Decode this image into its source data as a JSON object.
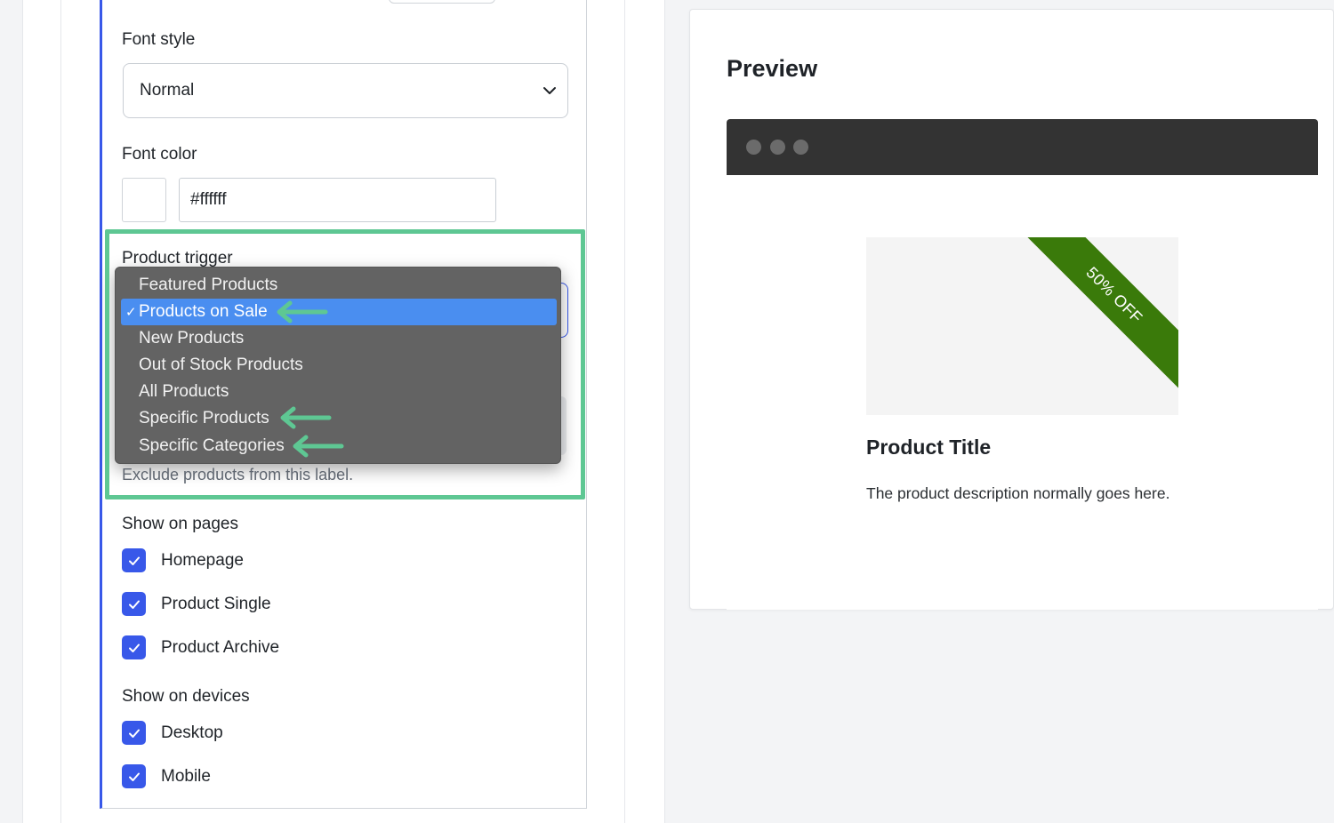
{
  "settings": {
    "font_style": {
      "label": "Font style",
      "value": "Normal"
    },
    "font_color": {
      "label": "Font color",
      "value": "#ffffff",
      "swatch_color": "#ffffff"
    },
    "product_trigger": {
      "label": "Product trigger",
      "options": [
        {
          "label": "Featured Products",
          "selected": false
        },
        {
          "label": "Products on Sale",
          "selected": true
        },
        {
          "label": "New Products",
          "selected": false
        },
        {
          "label": "Out of Stock Products",
          "selected": false
        },
        {
          "label": "All Products",
          "selected": false
        },
        {
          "label": "Specific Products",
          "selected": false
        },
        {
          "label": "Specific Categories",
          "selected": false
        }
      ],
      "check_glyph": "✓",
      "exclude_help": "Exclude products from this label."
    },
    "show_on_pages": {
      "label": "Show on pages",
      "items": [
        {
          "label": "Homepage",
          "checked": true
        },
        {
          "label": "Product Single",
          "checked": true
        },
        {
          "label": "Product Archive",
          "checked": true
        }
      ]
    },
    "show_on_devices": {
      "label": "Show on devices",
      "items": [
        {
          "label": "Desktop",
          "checked": true
        },
        {
          "label": "Mobile",
          "checked": true
        }
      ]
    }
  },
  "preview": {
    "heading": "Preview",
    "badge_text": "50% OFF",
    "badge_color": "#3a7a0a",
    "product_title": "Product Title",
    "product_description": "The product description normally goes here."
  },
  "colors": {
    "accent": "#3858e9",
    "annotation": "#5ec793",
    "dropdown_bg": "#636363",
    "dropdown_selected": "#4a8ef0"
  }
}
